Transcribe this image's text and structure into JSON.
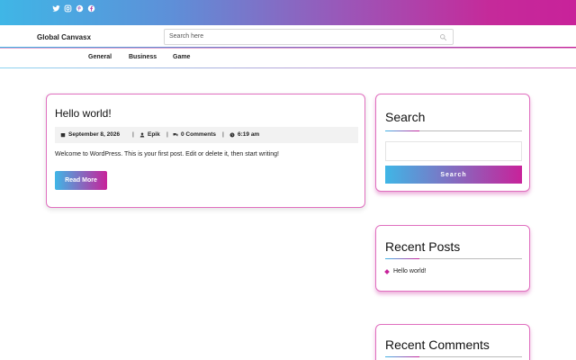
{
  "topbar": {
    "social_icons": [
      "twitter-icon",
      "instagram-icon",
      "pinterest-icon",
      "facebook-icon"
    ],
    "gradient": [
      "#3fb6e6",
      "#c8229a"
    ]
  },
  "header": {
    "site_title": "Global Canvasx",
    "search_placeholder": "Search here"
  },
  "nav": {
    "items": [
      "General",
      "Business",
      "Game"
    ]
  },
  "post": {
    "title": "Hello world!",
    "date": "September 8, 2026",
    "author": "Epik",
    "comments": "0 Comments",
    "time": "6:19 am",
    "excerpt": "Welcome to WordPress. This is your first post. Edit or delete it, then start writing!",
    "read_more": "Read More"
  },
  "sidebar": {
    "search": {
      "title": "Search",
      "button": "Search"
    },
    "recent_posts": {
      "title": "Recent Posts",
      "items": [
        "Hello world!"
      ]
    },
    "recent_comments": {
      "title": "Recent Comments"
    }
  },
  "colors": {
    "accent_start": "#3fb6e6",
    "accent_end": "#c8229a",
    "card_border": "#e06fbf"
  }
}
